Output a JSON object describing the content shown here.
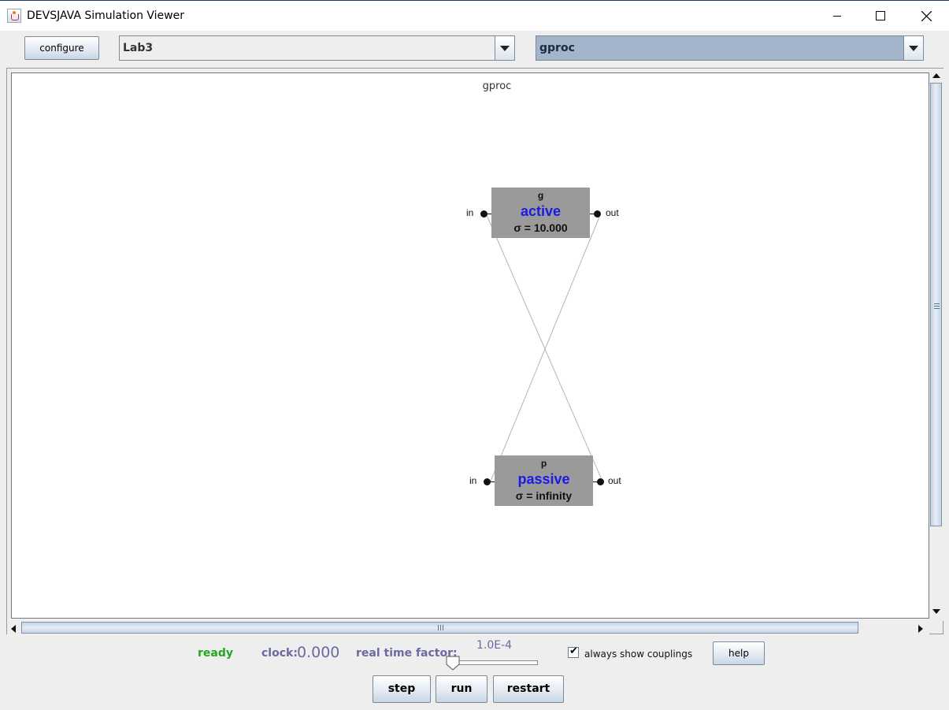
{
  "window": {
    "title": "DEVSJAVA Simulation Viewer",
    "controls": [
      "minimize-icon",
      "maximize-icon",
      "close-icon"
    ]
  },
  "toolbar": {
    "configure_label": "configure",
    "model_selected": "Lab3",
    "component_selected": "gproc"
  },
  "canvas": {
    "title": "gproc",
    "models": [
      {
        "name": "g",
        "phase": "active",
        "sigma": "σ = 10.000",
        "in_port": "in",
        "out_port": "out"
      },
      {
        "name": "p",
        "phase": "passive",
        "sigma": "σ = infinity",
        "in_port": "in",
        "out_port": "out"
      }
    ]
  },
  "status": {
    "state": "ready",
    "clock_label": "clock:",
    "clock_value": "0.000",
    "rtf_label": "real time factor:",
    "rtf_value": "1.0E-4",
    "rtf_slider_level": 0,
    "show_couplings_label": "always show couplings",
    "show_couplings_checked": true,
    "help_label": "help"
  },
  "controls": {
    "step_label": "step",
    "run_label": "run",
    "restart_label": "restart"
  },
  "colors": {
    "phase_text": "#1a1ae6",
    "ready_text": "#22a822",
    "clock_text": "#6a6aa0",
    "box_fill": "#9a9a9a",
    "selected_combo": "#a3b5cb"
  }
}
